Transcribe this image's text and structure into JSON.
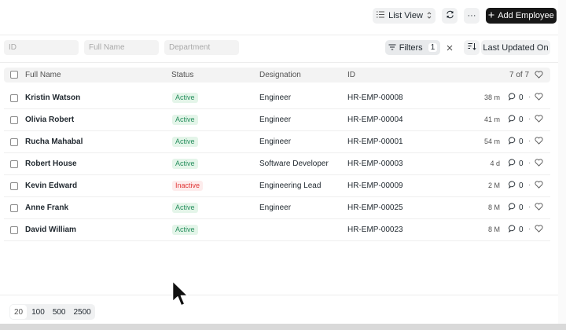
{
  "toolbar": {
    "list_view_label": "List View",
    "add_employee_label": "Add Employee",
    "more_label": "···"
  },
  "filters": {
    "id_placeholder": "ID",
    "full_name_placeholder": "Full Name",
    "department_placeholder": "Department",
    "filters_label": "Filters",
    "filters_count": "1",
    "sort_label": "Last Updated On"
  },
  "table": {
    "columns": {
      "full_name": "Full Name",
      "status": "Status",
      "designation": "Designation",
      "id": "ID",
      "count": "7 of 7"
    },
    "rows": [
      {
        "name": "Kristin Watson",
        "status": "Active",
        "designation": "Engineer",
        "id": "HR-EMP-00008",
        "time": "38 m",
        "comments": "0"
      },
      {
        "name": "Olivia Robert",
        "status": "Active",
        "designation": "Engineer",
        "id": "HR-EMP-00004",
        "time": "41 m",
        "comments": "0"
      },
      {
        "name": "Rucha Mahabal",
        "status": "Active",
        "designation": "Engineer",
        "id": "HR-EMP-00001",
        "time": "54 m",
        "comments": "0"
      },
      {
        "name": "Robert House",
        "status": "Active",
        "designation": "Software Developer",
        "id": "HR-EMP-00003",
        "time": "4 d",
        "comments": "0"
      },
      {
        "name": "Kevin Edward",
        "status": "Inactive",
        "designation": "Engineering Lead",
        "id": "HR-EMP-00009",
        "time": "2 M",
        "comments": "0"
      },
      {
        "name": "Anne Frank",
        "status": "Active",
        "designation": "Engineer",
        "id": "HR-EMP-00025",
        "time": "8 M",
        "comments": "0"
      },
      {
        "name": "David William",
        "status": "Active",
        "designation": "",
        "id": "HR-EMP-00023",
        "time": "8 M",
        "comments": "0"
      }
    ]
  },
  "pagination": {
    "sizes": [
      "20",
      "100",
      "500",
      "2500"
    ],
    "selected": "20"
  },
  "colors": {
    "active_text": "#278f5e",
    "active_bg": "#e4f5e9",
    "inactive_text": "#e03636",
    "inactive_bg": "#fdecec",
    "primary_button": "#171717"
  }
}
